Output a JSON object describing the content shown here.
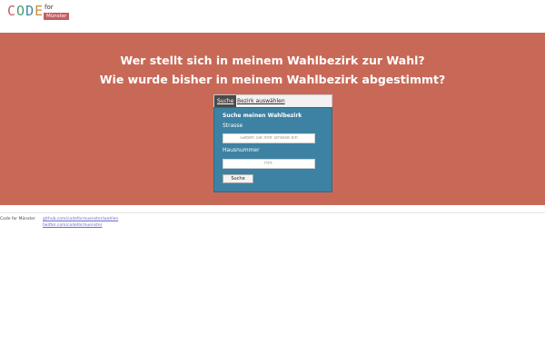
{
  "brand": {
    "logo_letters": [
      "C",
      "O",
      "D",
      "E"
    ],
    "logo_for": "for",
    "logo_city": "Münster",
    "colors": {
      "logo_red": "#c45e62",
      "logo_green": "#4b9b72",
      "logo_blue": "#3e86a6",
      "logo_orange": "#d08a3c"
    }
  },
  "hero": {
    "title_1": "Wer stellt sich in meinem Wahlbezirk zur Wahl?",
    "title_2": "Wie wurde bisher in meinem Wahlbezirk abgestimmt?",
    "background_color": "#c86957"
  },
  "search_widget": {
    "tabs": [
      {
        "label": "Suche",
        "active": true
      },
      {
        "label": "Bezirk auswählen",
        "active": false
      }
    ],
    "panel_title": "Suche meinen Wahlbezirk",
    "street_label": "Strasse",
    "street_placeholder": "Geben Sie Ihre Strasse ein",
    "number_label": "Hausnummer",
    "number_placeholder": "Hnr.",
    "submit_label": "Suche",
    "panel_color": "#3d82a3"
  },
  "footer": {
    "org": "Code for Münster",
    "links": [
      "github.com/codeformuenster/wahlen",
      "twitter.com/codeformuenster"
    ]
  }
}
